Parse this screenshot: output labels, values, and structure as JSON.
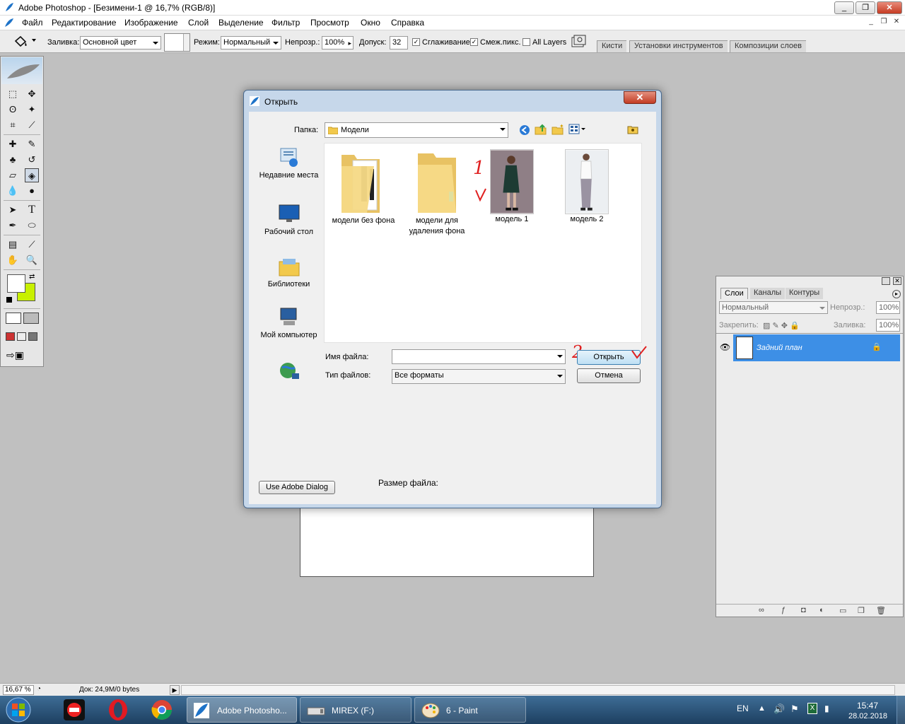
{
  "window": {
    "title": "Adobe Photoshop - [Безимени-1 @ 16,7% (RGB/8)]",
    "minimize": "_",
    "restore": "❐",
    "close": "✕"
  },
  "menu": {
    "items": [
      "Файл",
      "Редактирование",
      "Изображение",
      "Слой",
      "Выделение",
      "Фильтр",
      "Просмотр",
      "Окно",
      "Справка"
    ]
  },
  "options": {
    "fill_label": "Заливка:",
    "fill_value": "Основной цвет",
    "mode_label": "Режим:",
    "mode_value": "Нормальный",
    "opacity_label": "Непрозр.:",
    "opacity_value": "100%",
    "tolerance_label": "Допуск:",
    "tolerance_value": "32",
    "antialias_label": "Сглаживание",
    "contiguous_label": "Смеж.пикс.",
    "all_layers_label": "All Layers",
    "well_tabs": [
      "Кисти",
      "Установки инструментов",
      "Композиции слоев"
    ]
  },
  "dialog": {
    "title": "Открыть",
    "close": "✕",
    "folder_label": "Папка:",
    "folder_value": "Модели",
    "places": [
      "Недавние места",
      "Рабочий стол",
      "Библиотеки",
      "Мой компьютер"
    ],
    "files": [
      {
        "name": "модели без фона",
        "kind": "folder"
      },
      {
        "name": "модели для удаления фона",
        "kind": "folder"
      },
      {
        "name": "модель 1",
        "kind": "image"
      },
      {
        "name": "модель 2",
        "kind": "image"
      }
    ],
    "filename_label": "Имя файла:",
    "filename_value": "",
    "filetype_label": "Тип файлов:",
    "filetype_value": "Все форматы",
    "open_button": "Открыть",
    "cancel_button": "Отмена",
    "adobe_dialog_button": "Use Adobe Dialog",
    "filesize_label": "Размер файла:",
    "annotations": {
      "step1": "1",
      "step2": "2"
    }
  },
  "layers_panel": {
    "tabs": [
      "Слои",
      "Каналы",
      "Контуры"
    ],
    "blend_mode": "Нормальный",
    "opacity_label": "Непрозр.:",
    "opacity_value": "100%",
    "lock_label": "Закрепить:",
    "fill_label": "Заливка:",
    "fill_value": "100%",
    "layer_name": "Задний план"
  },
  "status": {
    "zoom": "16,67 %",
    "doc": "Док: 24,9M/0 bytes"
  },
  "taskbar": {
    "tasks": [
      "Adobe Photosho...",
      "MIREX (F:)",
      "6 - Paint"
    ],
    "lang": "EN",
    "time": "15:47",
    "date": "28.02.2018"
  },
  "colors": {
    "foreground": "#ffffff",
    "background": "#c8f000",
    "selected_layer": "#3d8fe6",
    "annotation": "#e02020"
  }
}
